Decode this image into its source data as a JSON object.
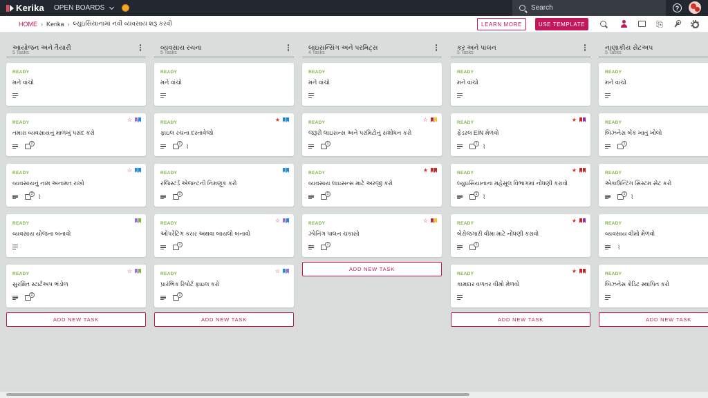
{
  "topbar": {
    "logo": "Kerika",
    "open_boards": "OPEN BOARDS",
    "search_placeholder": "Search"
  },
  "breadcrumb": {
    "home": "HOME",
    "org": "Kerika",
    "board": "લ્યુઇસિયાનામાં નવી વ્યવસાય શરૂ કરવી"
  },
  "actions": {
    "learn_more": "LEARN MORE",
    "use_template": "USE TEMPLATE"
  },
  "icons": {
    "toolbar": [
      "search-icon",
      "add-user-icon",
      "chat-icon",
      "attachment-icon",
      "wrench-icon",
      "gear-icon"
    ]
  },
  "colors": {
    "accent": "#c2185b",
    "ready": "#7cb342",
    "topbar": "#23272f",
    "board_bg": "#d9dedd"
  },
  "add_task_label": "ADD NEW TASK",
  "columns": [
    {
      "title": "આયોજન અને તૈયારી",
      "count": "5 Tasks",
      "show_add": true,
      "cards": [
        {
          "status": "READY",
          "title": "મને વાંચો",
          "check": "",
          "clip": false,
          "star": "",
          "flags": []
        },
        {
          "status": "READY",
          "title": "તમારા વ્યવસાયનું માળખું પસંદ કરો",
          "check": "2",
          "clip": false,
          "star": "outline",
          "flags": [
            "#9c6ade",
            "#1e88e5"
          ]
        },
        {
          "status": "READY",
          "title": "વ્યવસાયનું નામ અનામત રાખો",
          "check": "2",
          "clip": true,
          "star": "outline",
          "flags": [
            "#1e88e5",
            "#1e88e5"
          ]
        },
        {
          "status": "READY",
          "title": "વ્યવસાય યોજના બનાવો",
          "check": "",
          "clip": false,
          "star": "",
          "flags": [
            "#9c6ade",
            "#7cb342"
          ]
        },
        {
          "status": "READY",
          "title": "સુરક્ષિત સ્ટાર્ટઅપ ભંડોળ",
          "check": "2",
          "clip": false,
          "star": "outline",
          "flags": [
            "#9c6ade",
            "#7cb342"
          ]
        }
      ]
    },
    {
      "title": "વ્યવસાય રચના",
      "count": "5 Tasks",
      "show_add": true,
      "cards": [
        {
          "status": "READY",
          "title": "મને વાંચો",
          "check": "",
          "clip": false,
          "star": "",
          "flags": []
        },
        {
          "status": "READY",
          "title": "ફાઇલ રચના દસ્તાવેજો",
          "check": "2",
          "clip": true,
          "star": "filled",
          "flags": [
            "#1e88e5",
            "#1e88e5"
          ]
        },
        {
          "status": "READY",
          "title": "રજિસ્ટર્ડ એજન્ટની નિમણૂક કરો",
          "check": "1",
          "clip": false,
          "star": "",
          "flags": [
            "#1e88e5",
            "#1e88e5"
          ]
        },
        {
          "status": "READY",
          "title": "ઓપરેટિંગ કરાર અથવા બાયલો બનાવો",
          "check": "1",
          "clip": false,
          "star": "outline",
          "flags": [
            "#9c6ade",
            "#1e88e5"
          ]
        },
        {
          "status": "READY",
          "title": "પ્રારંભિક રિપોર્ટ ફાઇલ કરો",
          "check": "1",
          "clip": false,
          "star": "outline",
          "flags": [
            "#1e88e5",
            "#9c6ade"
          ]
        }
      ]
    },
    {
      "title": "લાઇસન્સિંગ અને પરમિટ્સ",
      "count": "4 Tasks",
      "show_add": true,
      "cards": [
        {
          "status": "READY",
          "title": "મને વાંચો",
          "check": "",
          "clip": false,
          "star": "",
          "flags": []
        },
        {
          "status": "READY",
          "title": "જરૂરી લાઇસન્સ અને પરમિટોનું સંશોધન કરો",
          "check": "1",
          "clip": false,
          "star": "outline",
          "flags": [
            "#c62828",
            "#fbc02d"
          ]
        },
        {
          "status": "READY",
          "title": "વ્યવસાય લાઇસન્સ માટે અરજી કરો",
          "check": "1",
          "clip": false,
          "star": "filled",
          "flags": [
            "#c62828",
            "#c62828"
          ]
        },
        {
          "status": "READY",
          "title": "ઝોનિંગ પાલન ચકાસો",
          "check": "1",
          "clip": false,
          "star": "outline",
          "flags": [
            "#c62828",
            "#fbc02d"
          ]
        }
      ]
    },
    {
      "title": "કર અને પાલન",
      "count": "5 Tasks",
      "show_add": true,
      "cards": [
        {
          "status": "READY",
          "title": "મને વાંચો",
          "check": "",
          "clip": false,
          "star": "",
          "flags": []
        },
        {
          "status": "READY",
          "title": "ફેડરલ EIN મેળવો",
          "check": "1",
          "clip": true,
          "star": "filled",
          "flags": [
            "#c62828",
            "#9c27b0"
          ]
        },
        {
          "status": "READY",
          "title": "લ્યુઇસિયાનાના મહેસૂલ વિભાગમાં નોંધણી કરાવો",
          "check": "1",
          "clip": true,
          "star": "filled",
          "flags": [
            "#c62828",
            "#c62828"
          ]
        },
        {
          "status": "READY",
          "title": "બેરોજગારી વીમા માટે નોંધણી કરાવો",
          "check": "1",
          "clip": false,
          "star": "filled",
          "flags": [
            "#c62828",
            "#9c27b0"
          ]
        },
        {
          "status": "READY",
          "title": "કામદાર વળતર વીમો મેળવો",
          "check": "",
          "clip": false,
          "star": "filled",
          "flags": [
            "#c62828",
            "#c62828"
          ]
        }
      ]
    },
    {
      "title": "નાણાકીય સેટઅપ",
      "count": "5 Tasks",
      "show_add": true,
      "cards": [
        {
          "status": "READY",
          "title": "મને વાંચો",
          "check": "",
          "clip": false,
          "star": "",
          "flags": []
        },
        {
          "status": "READY",
          "title": "બિઝનેસ બેંક ખાતું ખોલો",
          "check": "1",
          "clip": false,
          "star": "",
          "flags": []
        },
        {
          "status": "READY",
          "title": "એકાઉન્ટિંગ સિસ્ટમ સેટ કરો",
          "check": "1",
          "clip": true,
          "star": "",
          "flags": []
        },
        {
          "status": "READY",
          "title": "વ્યવસાય વીમો મેળવો",
          "check": "",
          "clip": true,
          "star": "",
          "flags": []
        },
        {
          "status": "READY",
          "title": "બિઝનેસ ક્રેડિટ સ્થાપિત કરો",
          "check": "",
          "clip": false,
          "star": "",
          "flags": []
        }
      ]
    }
  ]
}
